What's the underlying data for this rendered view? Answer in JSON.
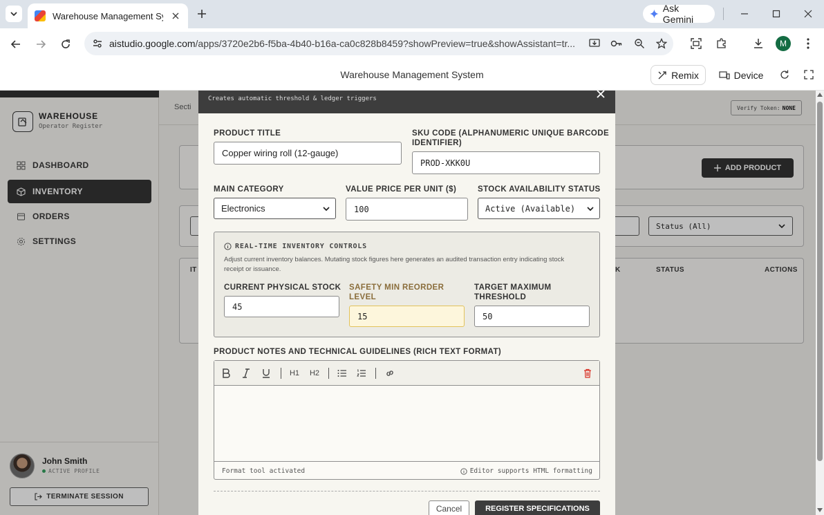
{
  "browser": {
    "tab_title": "Warehouse Management System",
    "gemini_label": "Ask Gemini",
    "url_host": "aistudio.google.com",
    "url_path": "/apps/3720e2b6-f5ba-4b40-b16a-ca0c828b8459?showPreview=true&showAssistant=tr...",
    "profile_initial": "M"
  },
  "studio": {
    "title": "Warehouse Management System",
    "remix_label": "Remix",
    "device_label": "Device"
  },
  "sidebar": {
    "brand_name": "WAREHOUSE",
    "brand_sub": "Operator Register",
    "items": [
      {
        "label": "DASHBOARD"
      },
      {
        "label": "INVENTORY"
      },
      {
        "label": "ORDERS"
      },
      {
        "label": "SETTINGS"
      }
    ],
    "user_name": "John Smith",
    "user_status": "ACTIVE PROFILE",
    "terminate_label": "TERMINATE SESSION"
  },
  "main": {
    "section_label": "Secti",
    "verify_label": "Verify Token:",
    "verify_value": "NONE",
    "add_product_label": "ADD PRODUCT",
    "status_filter": "Status (All)",
    "col_left": "IT",
    "col_k": "K",
    "col_status": "STATUS",
    "col_actions": "ACTIONS"
  },
  "modal": {
    "subtitle": "Creates automatic threshold & ledger triggers",
    "product_title_label": "PRODUCT TITLE",
    "product_title_value": "Copper wiring roll (12-gauge)",
    "sku_label_1": "SKU CODE (ALPHANUMERIC UNIQUE BARCODE",
    "sku_label_2": "IDENTIFIER)",
    "sku_value": "PROD-XKK0U",
    "category_label": "MAIN CATEGORY",
    "category_value": "Electronics",
    "price_label": "VALUE PRICE PER UNIT ($)",
    "price_value": "100",
    "availability_label": "STOCK AVAILABILITY STATUS",
    "availability_value": "Active (Available)",
    "controls_title": "REAL-TIME INVENTORY CONTROLS",
    "controls_desc": "Adjust current inventory balances. Mutating stock figures here generates an audited transaction entry indicating stock receipt or issuance.",
    "stock_label": "CURRENT PHYSICAL STOCK",
    "stock_value": "45",
    "min_label_1": "SAFETY MIN REORDER",
    "min_label_2": "LEVEL",
    "min_value": "15",
    "max_label_1": "TARGET MAXIMUM",
    "max_label_2": "THRESHOLD",
    "max_value": "50",
    "notes_label": "PRODUCT NOTES AND TECHNICAL GUIDELINES (RICH TEXT FORMAT)",
    "h1_label": "H1",
    "h2_label": "H2",
    "editor_status": "Format tool activated",
    "editor_hint": "Editor supports HTML formatting",
    "cancel_label": "Cancel",
    "register_label": "REGISTER SPECIFICATIONS"
  },
  "colors": {
    "modal_header": "#3d3d3d",
    "warning_field": "#fdf6dc",
    "delete_icon": "#d93025",
    "active_nav": "#2f2f2f"
  }
}
